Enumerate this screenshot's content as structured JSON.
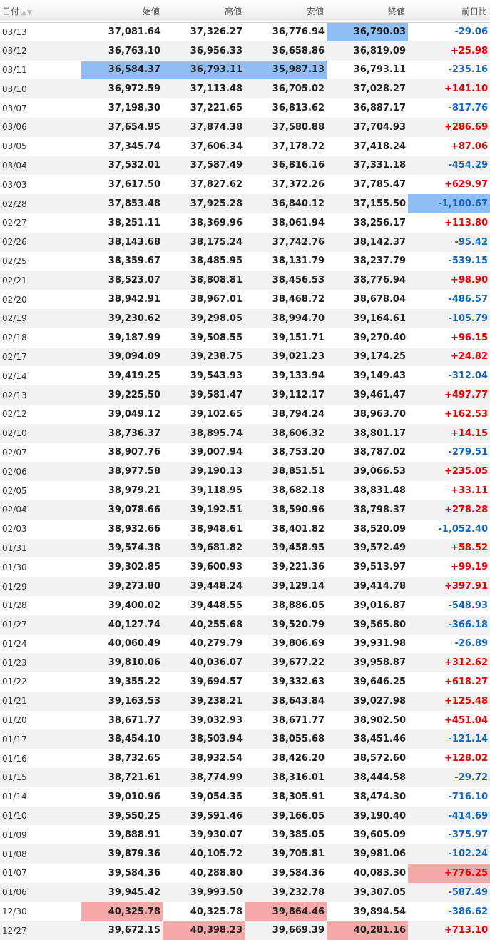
{
  "headers": [
    "日付",
    "始値",
    "高値",
    "安値",
    "終値",
    "前日比"
  ],
  "sort_indicator": "▲▼",
  "colors": {
    "highlight_blue": "#8fbef4",
    "highlight_red": "#f6a9a9",
    "positive": "#ee0000",
    "negative": "#1565c0"
  },
  "rows": [
    [
      "03/13",
      "37,081.64",
      "37,326.27",
      "36,776.94",
      "36,790.03",
      "-29.06"
    ],
    [
      "03/12",
      "36,763.10",
      "36,956.33",
      "36,658.86",
      "36,819.09",
      "+25.98"
    ],
    [
      "03/11",
      "36,584.37",
      "36,793.11",
      "35,987.13",
      "36,793.11",
      "-235.16"
    ],
    [
      "03/10",
      "36,972.59",
      "37,113.48",
      "36,705.02",
      "37,028.27",
      "+141.10"
    ],
    [
      "03/07",
      "37,198.30",
      "37,221.65",
      "36,813.62",
      "36,887.17",
      "-817.76"
    ],
    [
      "03/06",
      "37,654.95",
      "37,874.38",
      "37,580.88",
      "37,704.93",
      "+286.69"
    ],
    [
      "03/05",
      "37,345.74",
      "37,606.34",
      "37,178.72",
      "37,418.24",
      "+87.06"
    ],
    [
      "03/04",
      "37,532.01",
      "37,587.49",
      "36,816.16",
      "37,331.18",
      "-454.29"
    ],
    [
      "03/03",
      "37,617.50",
      "37,827.62",
      "37,372.26",
      "37,785.47",
      "+629.97"
    ],
    [
      "02/28",
      "37,853.48",
      "37,925.28",
      "36,840.12",
      "37,155.50",
      "-1,100.67"
    ],
    [
      "02/27",
      "38,251.11",
      "38,369.96",
      "38,061.94",
      "38,256.17",
      "+113.80"
    ],
    [
      "02/26",
      "38,143.68",
      "38,175.24",
      "37,742.76",
      "38,142.37",
      "-95.42"
    ],
    [
      "02/25",
      "38,359.67",
      "38,485.95",
      "38,131.79",
      "38,237.79",
      "-539.15"
    ],
    [
      "02/21",
      "38,523.07",
      "38,808.81",
      "38,456.53",
      "38,776.94",
      "+98.90"
    ],
    [
      "02/20",
      "38,942.91",
      "38,967.01",
      "38,468.72",
      "38,678.04",
      "-486.57"
    ],
    [
      "02/19",
      "39,230.62",
      "39,298.05",
      "38,994.70",
      "39,164.61",
      "-105.79"
    ],
    [
      "02/18",
      "39,187.99",
      "39,508.55",
      "39,151.71",
      "39,270.40",
      "+96.15"
    ],
    [
      "02/17",
      "39,094.09",
      "39,238.75",
      "39,021.23",
      "39,174.25",
      "+24.82"
    ],
    [
      "02/14",
      "39,419.25",
      "39,543.93",
      "39,133.94",
      "39,149.43",
      "-312.04"
    ],
    [
      "02/13",
      "39,225.50",
      "39,581.47",
      "39,112.17",
      "39,461.47",
      "+497.77"
    ],
    [
      "02/12",
      "39,049.12",
      "39,102.65",
      "38,794.24",
      "38,963.70",
      "+162.53"
    ],
    [
      "02/10",
      "38,736.37",
      "38,895.74",
      "38,606.32",
      "38,801.17",
      "+14.15"
    ],
    [
      "02/07",
      "38,907.76",
      "39,007.94",
      "38,753.20",
      "38,787.02",
      "-279.51"
    ],
    [
      "02/06",
      "38,977.58",
      "39,190.13",
      "38,851.51",
      "39,066.53",
      "+235.05"
    ],
    [
      "02/05",
      "38,979.21",
      "39,118.95",
      "38,682.18",
      "38,831.48",
      "+33.11"
    ],
    [
      "02/04",
      "39,078.66",
      "39,192.51",
      "38,590.96",
      "38,798.37",
      "+278.28"
    ],
    [
      "02/03",
      "38,932.66",
      "38,948.61",
      "38,401.82",
      "38,520.09",
      "-1,052.40"
    ],
    [
      "01/31",
      "39,574.38",
      "39,681.82",
      "39,458.95",
      "39,572.49",
      "+58.52"
    ],
    [
      "01/30",
      "39,302.85",
      "39,600.93",
      "39,221.36",
      "39,513.97",
      "+99.19"
    ],
    [
      "01/29",
      "39,273.80",
      "39,448.24",
      "39,129.14",
      "39,414.78",
      "+397.91"
    ],
    [
      "01/28",
      "39,400.02",
      "39,448.55",
      "38,886.05",
      "39,016.87",
      "-548.93"
    ],
    [
      "01/27",
      "40,127.74",
      "40,255.68",
      "39,520.79",
      "39,565.80",
      "-366.18"
    ],
    [
      "01/24",
      "40,060.49",
      "40,279.79",
      "39,806.69",
      "39,931.98",
      "-26.89"
    ],
    [
      "01/23",
      "39,810.06",
      "40,036.07",
      "39,677.22",
      "39,958.87",
      "+312.62"
    ],
    [
      "01/22",
      "39,355.22",
      "39,694.57",
      "39,332.63",
      "39,646.25",
      "+618.27"
    ],
    [
      "01/21",
      "39,163.53",
      "39,238.21",
      "38,643.84",
      "39,027.98",
      "+125.48"
    ],
    [
      "01/20",
      "38,671.77",
      "39,032.93",
      "38,671.77",
      "38,902.50",
      "+451.04"
    ],
    [
      "01/17",
      "38,454.10",
      "38,503.94",
      "38,055.68",
      "38,451.46",
      "-121.14"
    ],
    [
      "01/16",
      "38,732.65",
      "38,932.54",
      "38,426.20",
      "38,572.60",
      "+128.02"
    ],
    [
      "01/15",
      "38,721.61",
      "38,774.99",
      "38,316.01",
      "38,444.58",
      "-29.72"
    ],
    [
      "01/14",
      "39,010.96",
      "39,054.35",
      "38,305.91",
      "38,474.30",
      "-716.10"
    ],
    [
      "01/10",
      "39,550.25",
      "39,591.46",
      "39,166.05",
      "39,190.40",
      "-414.69"
    ],
    [
      "01/09",
      "39,888.91",
      "39,930.07",
      "39,385.05",
      "39,605.09",
      "-375.97"
    ],
    [
      "01/08",
      "39,879.36",
      "40,105.72",
      "39,705.81",
      "39,981.06",
      "-102.24"
    ],
    [
      "01/07",
      "39,584.36",
      "40,288.80",
      "39,584.36",
      "40,083.30",
      "+776.25"
    ],
    [
      "01/06",
      "39,945.42",
      "39,993.50",
      "39,232.78",
      "39,307.05",
      "-587.49"
    ],
    [
      "12/30",
      "40,325.78",
      "40,325.78",
      "39,864.46",
      "39,894.54",
      "-386.62"
    ],
    [
      "12/27",
      "39,672.15",
      "40,398.23",
      "39,669.39",
      "40,281.16",
      "+713.10"
    ]
  ],
  "highlights": {
    "blue": [
      [
        0,
        4
      ],
      [
        2,
        1
      ],
      [
        2,
        2
      ],
      [
        2,
        3
      ],
      [
        9,
        5
      ]
    ],
    "red": [
      [
        44,
        5
      ],
      [
        46,
        1
      ],
      [
        46,
        3
      ],
      [
        47,
        2
      ],
      [
        47,
        4
      ]
    ]
  }
}
